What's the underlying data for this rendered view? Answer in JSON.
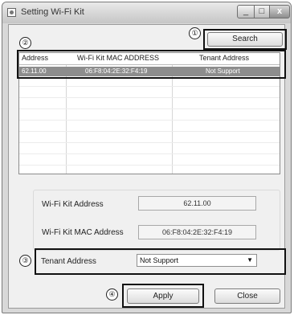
{
  "window": {
    "title": "Setting Wi-Fi Kit"
  },
  "markers": {
    "one": "①",
    "two": "②",
    "three": "③",
    "four": "④"
  },
  "buttons": {
    "search": "Search",
    "apply": "Apply",
    "close": "Close"
  },
  "table": {
    "columns": [
      "Address",
      "Wi-Fi Kit MAC ADDRESS",
      "Tenant Address"
    ],
    "rows": [
      [
        "62.11.00",
        "06:F8:04:2E:32:F4:19",
        "Not Support"
      ]
    ]
  },
  "form": {
    "kit_address_label": "Wi-Fi Kit Address",
    "kit_address_value": "62.11.00",
    "mac_label": "Wi-Fi Kit MAC Address",
    "mac_value": "06:F8:04:2E:32:F4:19",
    "tenant_label": "Tenant Address",
    "tenant_value": "Not Support"
  },
  "icons": {
    "window": "window-icon",
    "minimize": "minimize-icon",
    "maximize": "maximize-icon",
    "close": "close-icon",
    "dropdown": "chevron-down-icon"
  }
}
